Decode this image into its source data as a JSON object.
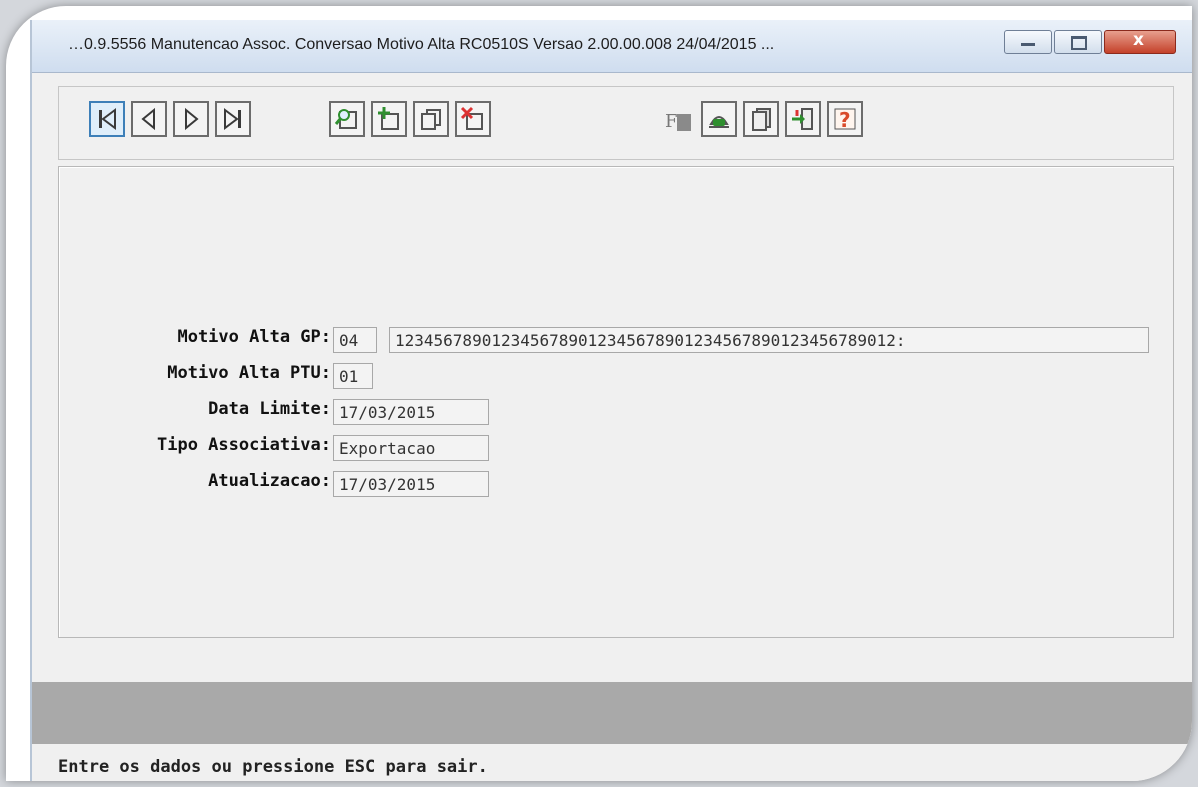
{
  "window": {
    "title": "…0.9.5556 Manutencao  Assoc. Conversao Motivo Alta RC0510S Versao 2.00.00.008 24/04/2015 ...",
    "min_icon": "minimize-icon",
    "max_icon": "maximize-icon",
    "close_icon": "close-icon"
  },
  "toolbar": {
    "navigation": [
      "first-record-icon",
      "previous-record-icon",
      "next-record-icon",
      "last-record-icon"
    ],
    "actions": [
      "search-icon",
      "add-record-icon",
      "copy-record-icon",
      "delete-record-icon"
    ],
    "tools": [
      "filter-icon",
      "print-icon",
      "pages-icon",
      "exit-icon",
      "help-icon"
    ],
    "help_glyph": "?"
  },
  "form": {
    "motivo_gp_label": "Motivo Alta GP:",
    "motivo_gp_code": "04",
    "motivo_gp_desc": "1234567890123456789012345678901234567890123456789012:",
    "motivo_ptu_label": "Motivo Alta PTU:",
    "motivo_ptu_code": "01",
    "data_limite_label": "Data Limite:",
    "data_limite_value": "17/03/2015",
    "tipo_assoc_label": "Tipo Associativa:",
    "tipo_assoc_value": "Exportacao",
    "atualizacao_label": "Atualizacao:",
    "atualizacao_value": "17/03/2015"
  },
  "status_bar": {
    "message": "Entre os dados ou pressione ESC para sair."
  },
  "colors": {
    "title_gradient_top": "#eaf1f9",
    "close_button": "#c4412a",
    "accent_green": "#2f8f2f",
    "help_icon": "#d94a2a",
    "status_gray": "#a9a9a9"
  }
}
